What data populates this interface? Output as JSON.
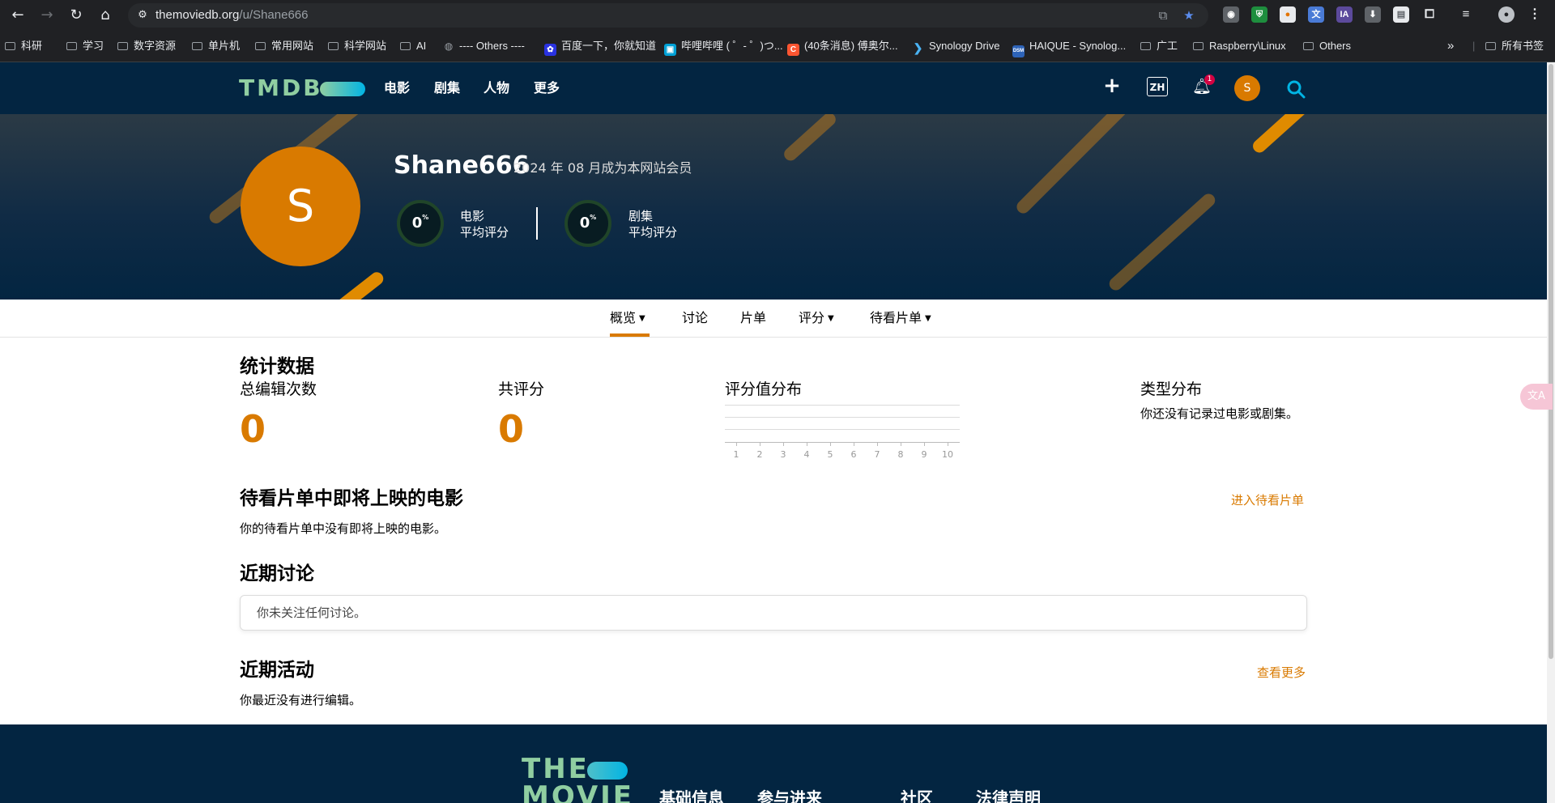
{
  "browser": {
    "url_host": "themoviedb.org",
    "url_path": "/u/Shane666",
    "bookmarks": [
      {
        "label": "科研",
        "type": "folder"
      },
      {
        "label": "学习",
        "type": "folder"
      },
      {
        "label": "数字资源",
        "type": "folder"
      },
      {
        "label": "单片机",
        "type": "folder"
      },
      {
        "label": "常用网站",
        "type": "folder"
      },
      {
        "label": "科学网站",
        "type": "folder"
      },
      {
        "label": "AI",
        "type": "folder"
      },
      {
        "label": "---- Others ----",
        "type": "site"
      },
      {
        "label": "百度一下，你就知道",
        "type": "site"
      },
      {
        "label": "哔哩哔哩 ( ゜- ゜)つ...",
        "type": "site"
      },
      {
        "label": "(40条消息) 傅奥尔...",
        "type": "site"
      },
      {
        "label": "Synology Drive",
        "type": "site"
      },
      {
        "label": "HAIQUE - Synolog...",
        "type": "site"
      },
      {
        "label": "广工",
        "type": "folder"
      },
      {
        "label": "Raspberry\\Linux",
        "type": "folder"
      },
      {
        "label": "Others",
        "type": "folder"
      }
    ],
    "overflow": "»",
    "all_bookmarks": "所有书签",
    "ext_ia": "IA",
    "dsm": "DSM"
  },
  "header": {
    "logo": "TMDB",
    "nav": [
      "电影",
      "剧集",
      "人物",
      "更多"
    ],
    "lang": "ZH",
    "notification_count": "1",
    "avatar_letter": "S"
  },
  "profile": {
    "avatar_letter": "S",
    "username": "Shane666",
    "member_since": "2024 年 08 月成为本网站会员",
    "movie_score": "0",
    "movie_label_1": "电影",
    "movie_label_2": "平均评分",
    "tv_score": "0",
    "tv_label_1": "剧集",
    "tv_label_2": "平均评分",
    "percent": "%"
  },
  "subnav": {
    "items": [
      "概览",
      "讨论",
      "片单",
      "评分",
      "待看片单"
    ],
    "active": "概览"
  },
  "stats": {
    "title": "统计数据",
    "total_edits_label": "总编辑次数",
    "total_edits_value": "0",
    "total_ratings_label": "共评分",
    "total_ratings_value": "0",
    "rating_dist_label": "评分值分布",
    "rating_ticks": [
      "1",
      "2",
      "3",
      "4",
      "5",
      "6",
      "7",
      "8",
      "9",
      "10"
    ],
    "genre_dist_label": "类型分布",
    "genre_dist_empty": "你还没有记录过电影或剧集。"
  },
  "watchlist": {
    "title": "待看片单中即将上映的电影",
    "link": "进入待看片单",
    "empty": "你的待看片单中没有即将上映的电影。"
  },
  "discussions": {
    "title": "近期讨论",
    "empty": "你未关注任何讨论。"
  },
  "activity": {
    "title": "近期活动",
    "link": "查看更多",
    "empty": "你最近没有进行编辑。"
  },
  "footer": {
    "logo": "THE MOVIE",
    "columns": [
      "基础信息",
      "参与进来",
      "社区",
      "法律声明"
    ]
  },
  "colors": {
    "tmdb_navy": "#032541",
    "accent_orange": "#d97a00",
    "logo_green": "#90cea1",
    "logo_blue": "#01b4e4"
  }
}
